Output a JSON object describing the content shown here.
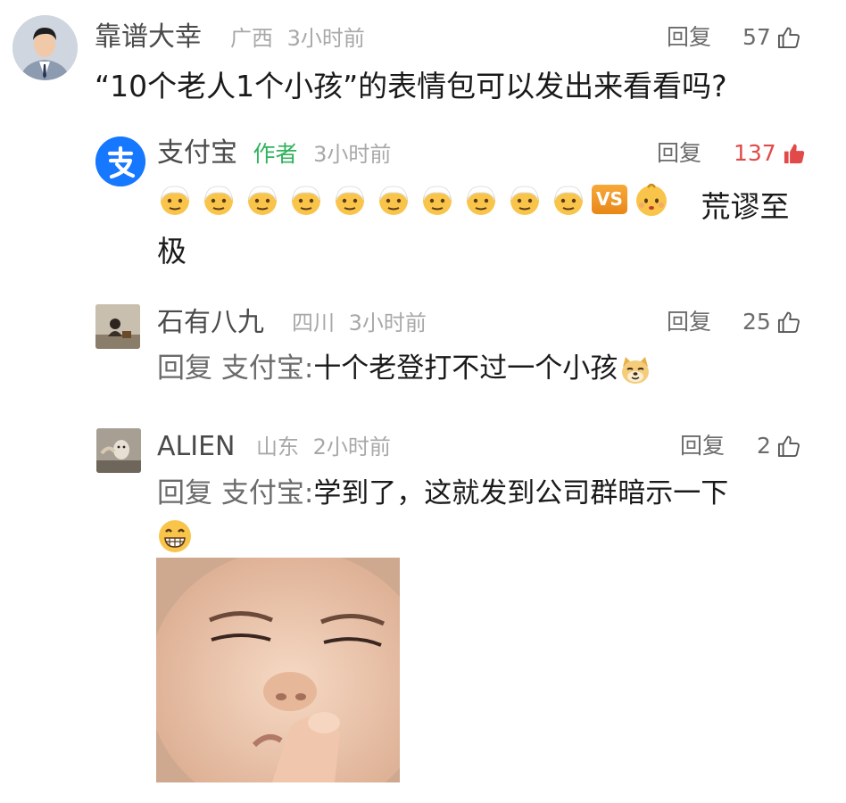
{
  "comments": [
    {
      "name": "靠谱大幸",
      "location": "广西",
      "time": "3小时前",
      "reply_label": "回复",
      "likes": "57",
      "content": "“10个老人1个小孩”的表情包可以发出来看看吗?"
    },
    {
      "name": "支付宝",
      "author_tag": "作者",
      "time": "3小时前",
      "reply_label": "回复",
      "likes": "137",
      "content_emojis": [
        "older-man-emoji",
        "older-man-emoji",
        "older-man-emoji",
        "older-man-emoji",
        "older-man-emoji",
        "older-man-emoji",
        "older-man-emoji",
        "older-man-emoji",
        "older-man-emoji",
        "older-man-emoji",
        "vs-emoji",
        "baby-emoji"
      ],
      "vs_text": "VS",
      "content_text_1": "荒谬至",
      "content_text_2": "极"
    },
    {
      "name": "石有八九",
      "location": "四川",
      "time": "3小时前",
      "reply_label": "回复",
      "likes": "25",
      "reply_prefix": "回复 支付宝:",
      "content": "十个老登打不过一个小孩"
    },
    {
      "name": "ALIEN",
      "location": "山东",
      "time": "2小时前",
      "reply_label": "回复",
      "likes": "2",
      "reply_prefix": "回复 支付宝:",
      "content": "学到了，这就发到公司群暗示一下"
    }
  ],
  "colors": {
    "name": "#4a4a4a",
    "meta": "#a8a8a8",
    "author_tag": "#2fb35c",
    "liked": "#e14a49",
    "alipay_blue": "#1677ff"
  }
}
